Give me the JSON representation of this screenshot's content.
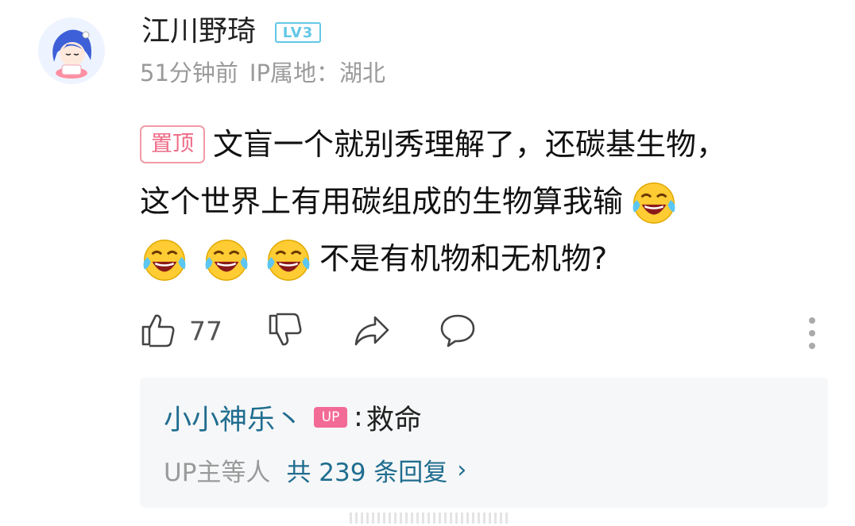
{
  "comment": {
    "username": "江川野琦",
    "level_badge": "LV3",
    "time": "51分钟前",
    "ip_location": "IP属地：湖北",
    "pin_label": "置顶",
    "text_lines": [
      "文盲一个就别秀理解了，还碳基生物，",
      "这个世界上有用碳组成的生物算我输",
      "不是有机物和无机物?"
    ],
    "emoji": "laughing-crying-emoji",
    "like_count": "77"
  },
  "reply": {
    "name": "小小神乐丶",
    "badge": "UP",
    "separator": ":",
    "text": "救命",
    "footer_who": "UP主等人",
    "footer_count": "共 239 条回复",
    "footer_chevron": "›"
  },
  "colors": {
    "accent_blue": "#1f6d8f",
    "level_blue": "#62c7e7",
    "pin_pink": "#f06a86",
    "up_pink": "#f26a96",
    "meta_gray": "#9a9a9a"
  }
}
